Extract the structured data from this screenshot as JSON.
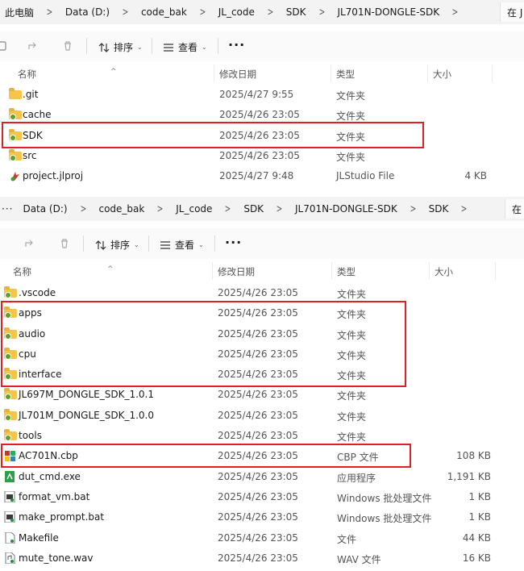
{
  "pane1": {
    "breadcrumb": [
      "此电脑",
      "Data (D:)",
      "code_bak",
      "JL_code",
      "SDK",
      "JL701N-DONGLE-SDK"
    ],
    "search_placeholder": "在 J",
    "toolbar": {
      "sort_label": "排序",
      "view_label": "查看",
      "more_label": "···"
    },
    "columns": {
      "name": "名称",
      "date": "修改日期",
      "type": "类型",
      "size": "大小"
    },
    "files": [
      {
        "name": ".git",
        "date": "2025/4/27 9:55",
        "type": "文件夹",
        "size": "",
        "icon": "folder-icon"
      },
      {
        "name": "cache",
        "date": "2025/4/26 23:05",
        "type": "文件夹",
        "size": "",
        "icon": "folder-synced-icon"
      },
      {
        "name": "SDK",
        "date": "2025/4/26 23:05",
        "type": "文件夹",
        "size": "",
        "icon": "folder-synced-icon"
      },
      {
        "name": "src",
        "date": "2025/4/26 23:05",
        "type": "文件夹",
        "size": "",
        "icon": "folder-synced-icon"
      },
      {
        "name": "project.jlproj",
        "date": "2025/4/27 9:48",
        "type": "JLStudio File",
        "size": "4 KB",
        "icon": "jlproj-file-icon"
      }
    ]
  },
  "pane2": {
    "breadcrumb": [
      "Data (D:)",
      "code_bak",
      "JL_code",
      "SDK",
      "JL701N-DONGLE-SDK",
      "SDK"
    ],
    "leading_ellipsis": "···",
    "search_placeholder": "在",
    "toolbar": {
      "sort_label": "排序",
      "view_label": "查看",
      "more_label": "···"
    },
    "columns": {
      "name": "名称",
      "date": "修改日期",
      "type": "类型",
      "size": "大小"
    },
    "files": [
      {
        "name": ".vscode",
        "date": "2025/4/26 23:05",
        "type": "文件夹",
        "size": "",
        "icon": "folder-synced-icon"
      },
      {
        "name": "apps",
        "date": "2025/4/26 23:05",
        "type": "文件夹",
        "size": "",
        "icon": "folder-synced-icon"
      },
      {
        "name": "audio",
        "date": "2025/4/26 23:05",
        "type": "文件夹",
        "size": "",
        "icon": "folder-synced-icon"
      },
      {
        "name": "cpu",
        "date": "2025/4/26 23:05",
        "type": "文件夹",
        "size": "",
        "icon": "folder-synced-icon"
      },
      {
        "name": "interface",
        "date": "2025/4/26 23:05",
        "type": "文件夹",
        "size": "",
        "icon": "folder-synced-icon"
      },
      {
        "name": "JL697M_DONGLE_SDK_1.0.1",
        "date": "2025/4/26 23:05",
        "type": "文件夹",
        "size": "",
        "icon": "folder-synced-icon"
      },
      {
        "name": "JL701M_DONGLE_SDK_1.0.0",
        "date": "2025/4/26 23:05",
        "type": "文件夹",
        "size": "",
        "icon": "folder-synced-icon"
      },
      {
        "name": "tools",
        "date": "2025/4/26 23:05",
        "type": "文件夹",
        "size": "",
        "icon": "folder-synced-icon"
      },
      {
        "name": "AC701N.cbp",
        "date": "2025/4/26 23:05",
        "type": "CBP 文件",
        "size": "108 KB",
        "icon": "codeblocks-project-icon"
      },
      {
        "name": "dut_cmd.exe",
        "date": "2025/4/26 23:05",
        "type": "应用程序",
        "size": "1,191 KB",
        "icon": "exe-file-icon"
      },
      {
        "name": "format_vm.bat",
        "date": "2025/4/26 23:05",
        "type": "Windows 批处理文件",
        "size": "1 KB",
        "icon": "bat-file-icon"
      },
      {
        "name": "make_prompt.bat",
        "date": "2025/4/26 23:05",
        "type": "Windows 批处理文件",
        "size": "1 KB",
        "icon": "bat-file-icon"
      },
      {
        "name": "Makefile",
        "date": "2025/4/26 23:05",
        "type": "文件",
        "size": "44 KB",
        "icon": "generic-file-icon"
      },
      {
        "name": "mute_tone.wav",
        "date": "2025/4/26 23:05",
        "type": "WAV 文件",
        "size": "16 KB",
        "icon": "audio-file-icon"
      }
    ]
  },
  "colors": {
    "highlight": "#e02020",
    "folder": "#f5c44b",
    "sync_badge": "#5aa02c",
    "address_bar": "#f3f3f3"
  }
}
